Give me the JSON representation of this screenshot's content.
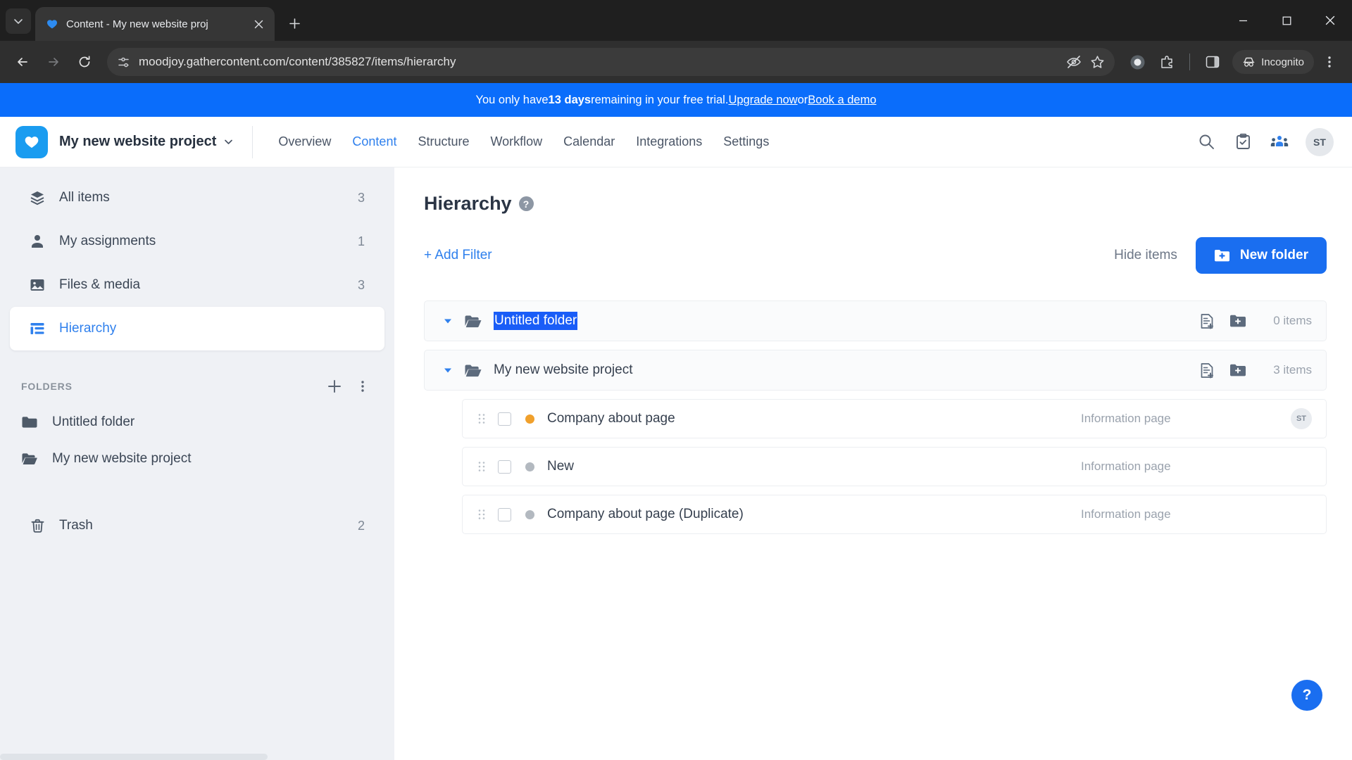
{
  "browser": {
    "tab": {
      "title": "Content - My new website proj",
      "favicon": "gathercontent-heart-icon"
    },
    "new_tab_label": "+",
    "url": "moodjoy.gathercontent.com/content/385827/items/hierarchy",
    "incognito_label": "Incognito",
    "window_controls": [
      "minimize",
      "maximize",
      "close"
    ]
  },
  "banner": {
    "prefix": "You only have ",
    "days": "13 days",
    "middle": " remaining in your free trial. ",
    "link1": "Upgrade now",
    "conjunction": " or ",
    "link2": "Book a demo"
  },
  "header": {
    "project_name": "My new website project",
    "nav": [
      {
        "label": "Overview",
        "active": false
      },
      {
        "label": "Content",
        "active": true
      },
      {
        "label": "Structure",
        "active": false
      },
      {
        "label": "Workflow",
        "active": false
      },
      {
        "label": "Calendar",
        "active": false
      },
      {
        "label": "Integrations",
        "active": false
      },
      {
        "label": "Settings",
        "active": false
      }
    ],
    "icons": [
      "search-icon",
      "tasks-clipboard-icon",
      "team-icon"
    ],
    "avatar_initials": "ST"
  },
  "sidebar": {
    "items": [
      {
        "label": "All items",
        "count": "3",
        "icon": "layers-icon",
        "active": false
      },
      {
        "label": "My assignments",
        "count": "1",
        "icon": "person-icon",
        "active": false
      },
      {
        "label": "Files & media",
        "count": "3",
        "icon": "image-icon",
        "active": false
      },
      {
        "label": "Hierarchy",
        "count": "",
        "icon": "hierarchy-icon",
        "active": true
      }
    ],
    "folders_section_label": "FOLDERS",
    "folders": [
      {
        "label": "Untitled folder",
        "icon": "folder-closed-icon"
      },
      {
        "label": "My new website project",
        "icon": "folder-open-icon"
      }
    ],
    "trash": {
      "label": "Trash",
      "count": "2",
      "icon": "trash-icon"
    }
  },
  "main": {
    "title": "Hierarchy",
    "title_help_glyph": "?",
    "add_filter": "+ Add Filter",
    "hide_items": "Hide items",
    "new_folder": "New folder",
    "help_fab_glyph": "?",
    "rows": [
      {
        "type": "folder",
        "name": "Untitled folder",
        "name_selected": true,
        "count": "0 items",
        "icon": "folder-open-icon",
        "actions": [
          "new-item-icon",
          "new-folder-icon"
        ]
      },
      {
        "type": "folder",
        "name": "My new website project",
        "name_selected": false,
        "count": "3 items",
        "icon": "folder-open-icon",
        "actions": [
          "new-item-icon",
          "new-folder-icon"
        ]
      },
      {
        "type": "item",
        "name": "Company about page",
        "template": "Information page",
        "status_color": "#f0a02c",
        "assignee": "ST"
      },
      {
        "type": "item",
        "name": "New",
        "template": "Information page",
        "status_color": "#b3b9c0",
        "assignee": ""
      },
      {
        "type": "item",
        "name": "Company about page (Duplicate)",
        "template": "Information page",
        "status_color": "#b3b9c0",
        "assignee": ""
      }
    ]
  },
  "colors": {
    "accent_blue": "#1a6ef0",
    "banner_blue": "#0a6dfb",
    "selection_blue": "#1a5df7",
    "status_amber": "#f0a02c",
    "status_grey": "#b3b9c0"
  }
}
